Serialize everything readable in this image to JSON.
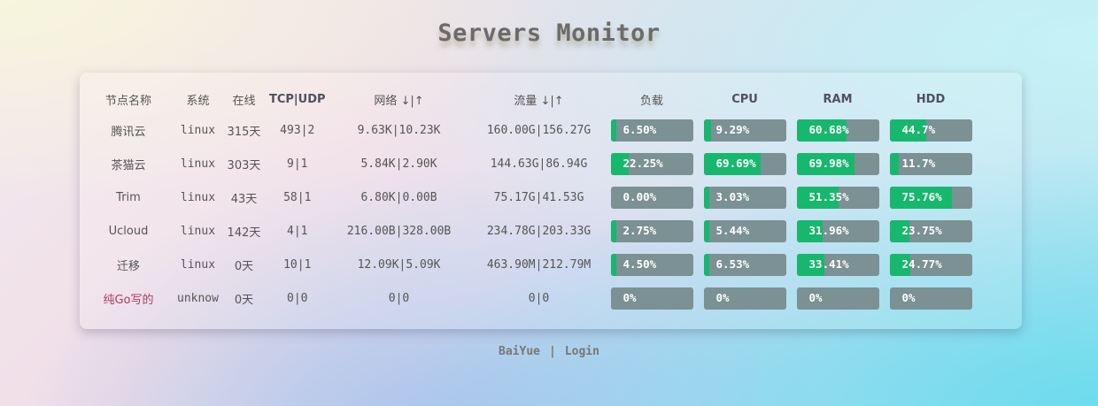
{
  "page": {
    "title": "Servers Monitor"
  },
  "table": {
    "headers": {
      "name": "节点名称",
      "os": "系统",
      "uptime": "在线",
      "tcpudp": "TCP|UDP",
      "network": "网络 ↓|↑",
      "traffic": "流量 ↓|↑",
      "load": "负载",
      "cpu": "CPU",
      "ram": "RAM",
      "hdd": "HDD"
    },
    "rows": [
      {
        "name": "腾讯云",
        "os": "linux",
        "uptime": "315天",
        "tcpudp": "493|2",
        "network": "9.63K|10.23K",
        "traffic": "160.00G|156.27G",
        "load": "6.50%",
        "load_value": 6.5,
        "cpu": "9.29%",
        "cpu_value": 9.29,
        "ram": "60.68%",
        "ram_value": 60.68,
        "hdd": "44.7%",
        "hdd_value": 44.7,
        "online": true
      },
      {
        "name": "茶猫云",
        "os": "linux",
        "uptime": "303天",
        "tcpudp": "9|1",
        "network": "5.84K|2.90K",
        "traffic": "144.63G|86.94G",
        "load": "22.25%",
        "load_value": 22.25,
        "cpu": "69.69%",
        "cpu_value": 69.69,
        "ram": "69.98%",
        "ram_value": 69.98,
        "hdd": "11.7%",
        "hdd_value": 11.7,
        "online": true
      },
      {
        "name": "Trim",
        "os": "linux",
        "uptime": "43天",
        "tcpudp": "58|1",
        "network": "6.80K|0.00B",
        "traffic": "75.17G|41.53G",
        "load": "0.00%",
        "load_value": 0,
        "cpu": "3.03%",
        "cpu_value": 3.03,
        "ram": "51.35%",
        "ram_value": 51.35,
        "hdd": "75.76%",
        "hdd_value": 75.76,
        "online": true
      },
      {
        "name": "Ucloud",
        "os": "linux",
        "uptime": "142天",
        "tcpudp": "4|1",
        "network": "216.00B|328.00B",
        "traffic": "234.78G|203.33G",
        "load": "2.75%",
        "load_value": 2.75,
        "cpu": "5.44%",
        "cpu_value": 5.44,
        "ram": "31.96%",
        "ram_value": 31.96,
        "hdd": "23.75%",
        "hdd_value": 23.75,
        "online": true
      },
      {
        "name": "迁移",
        "os": "linux",
        "uptime": "0天",
        "tcpudp": "10|1",
        "network": "12.09K|5.09K",
        "traffic": "463.90M|212.79M",
        "load": "4.50%",
        "load_value": 4.5,
        "cpu": "6.53%",
        "cpu_value": 6.53,
        "ram": "33.41%",
        "ram_value": 33.41,
        "hdd": "24.77%",
        "hdd_value": 24.77,
        "online": true
      },
      {
        "name": "纯Go写的",
        "os": "unknow",
        "uptime": "0天",
        "tcpudp": "0|0",
        "network": "0|0",
        "traffic": "0|0",
        "load": "0%",
        "load_value": 0,
        "cpu": "0%",
        "cpu_value": 0,
        "ram": "0%",
        "ram_value": 0,
        "hdd": "0%",
        "hdd_value": 0,
        "online": false
      }
    ]
  },
  "footer": {
    "author": "BaiYue",
    "separator": "|",
    "login": "Login"
  },
  "colors": {
    "bar_fill": "#17b86d",
    "bar_track": "#7b9193",
    "offline_name": "#b23a60"
  }
}
